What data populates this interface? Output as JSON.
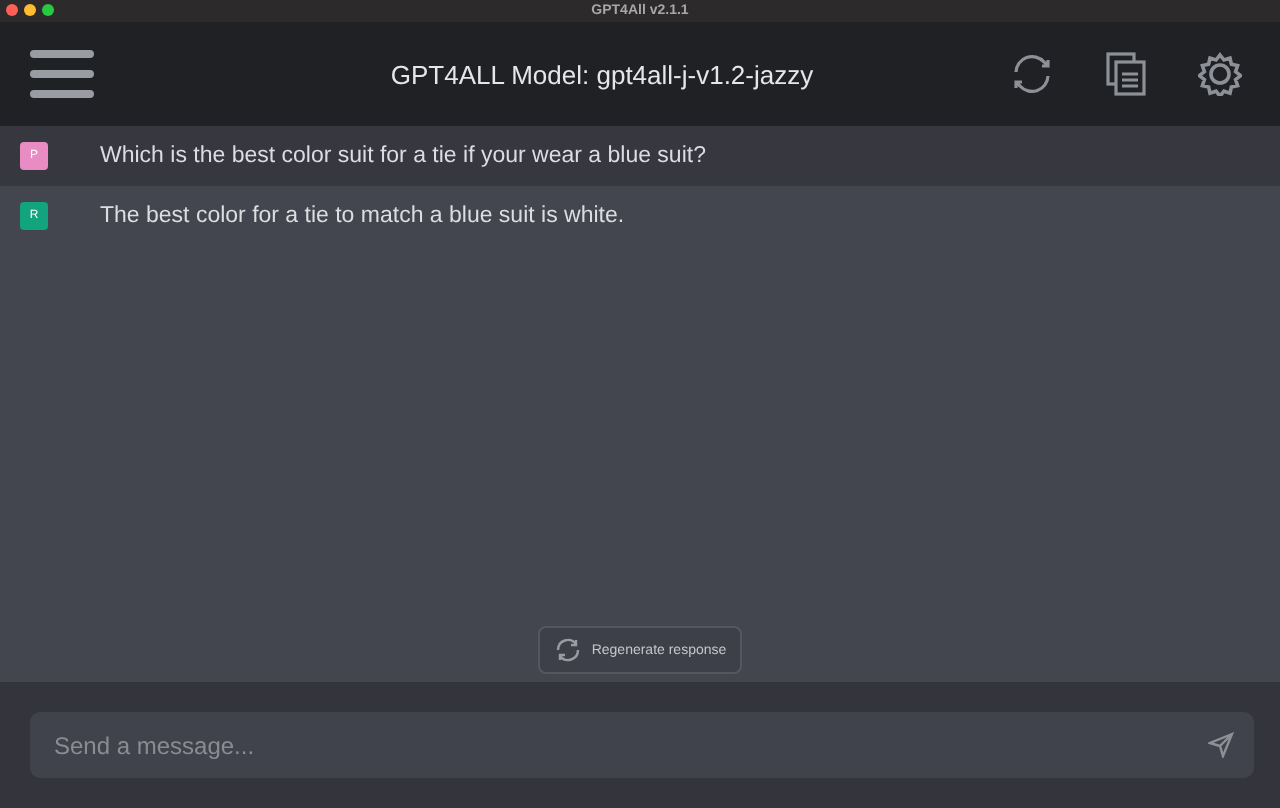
{
  "window": {
    "title": "GPT4All v2.1.1"
  },
  "header": {
    "title": "GPT4ALL Model: gpt4all-j-v1.2-jazzy"
  },
  "messages": [
    {
      "kind": "prompt",
      "avatar": "P",
      "color": "#e98cc4",
      "text": "Which is the best color suit for a tie if your wear a blue suit?"
    },
    {
      "kind": "response",
      "avatar": "R",
      "color": "#12a37f",
      "text": "The best color for a tie to match a blue suit is white."
    }
  ],
  "regenerate_button": {
    "label": "Regenerate response"
  },
  "input": {
    "placeholder": "Send a message..."
  }
}
